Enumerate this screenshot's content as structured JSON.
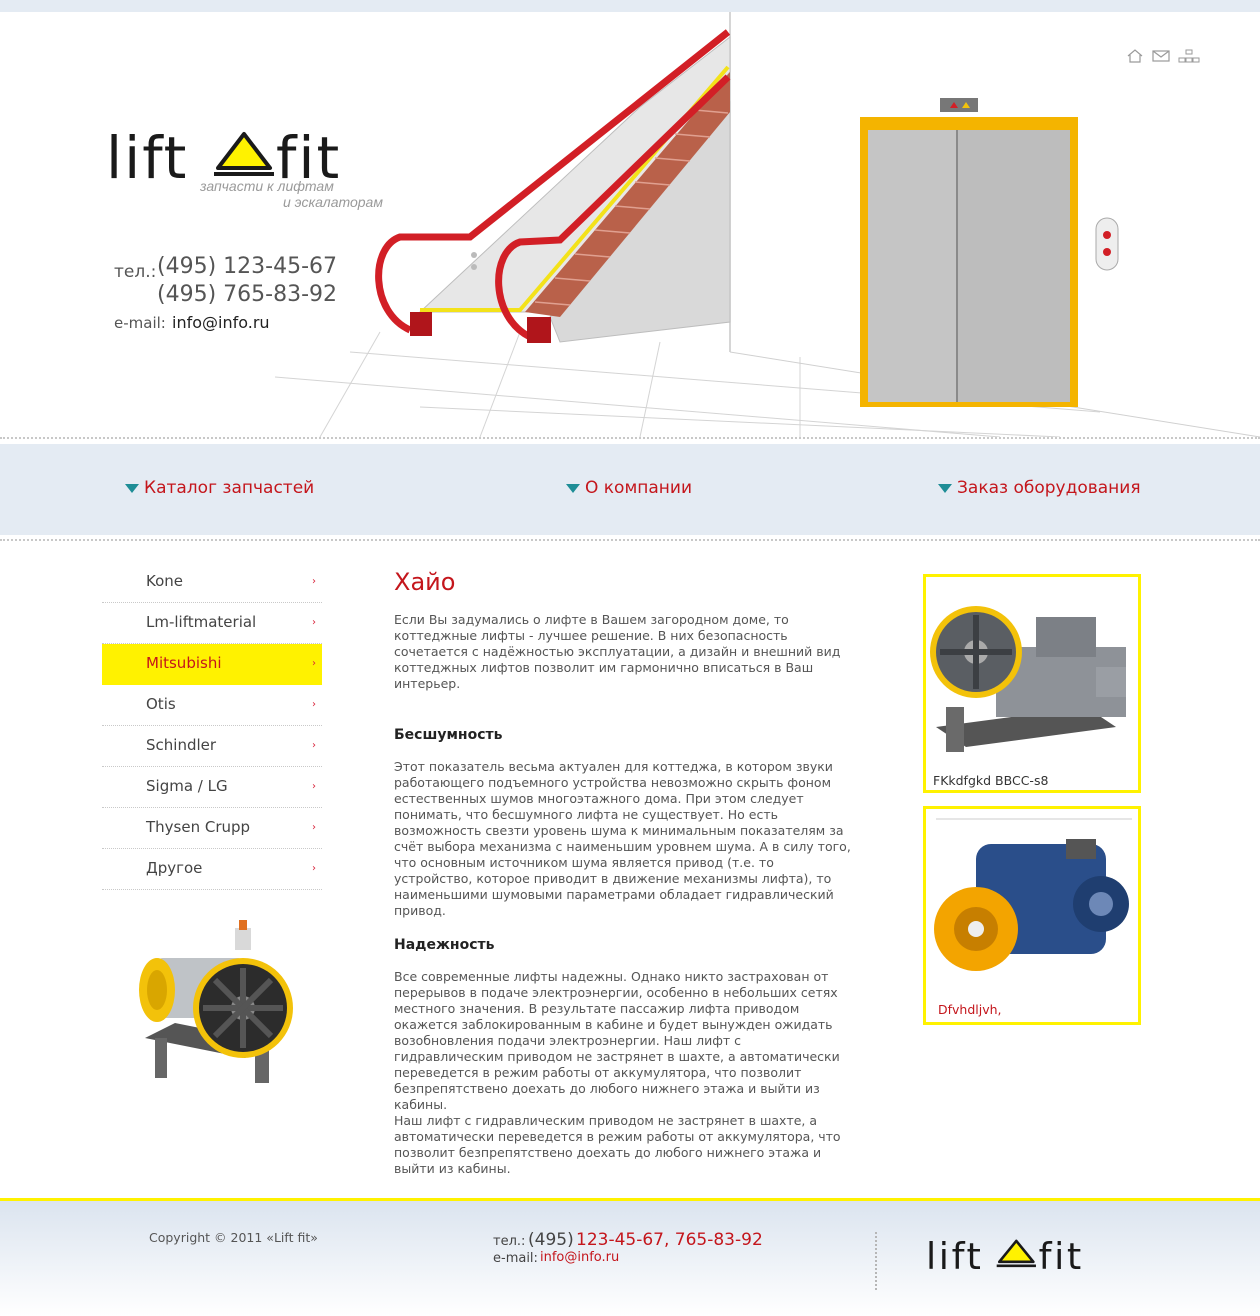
{
  "header": {
    "tagline_line1": "запчасти к лифтам",
    "tagline_line2": "и эскалаторам",
    "phone_label": "тел.:",
    "phone1": "(495) 123-45-67",
    "phone2": "(495) 765-83-92",
    "email_label": "e-mail:",
    "email": "info@info.ru",
    "icons": [
      "home-icon",
      "mail-icon",
      "sitemap-icon"
    ]
  },
  "nav": [
    {
      "label": "Каталог запчастей"
    },
    {
      "label": "О компании"
    },
    {
      "label": "Заказ оборудования"
    }
  ],
  "sidebar": {
    "active_index": 2,
    "items": [
      {
        "label": "Kone"
      },
      {
        "label": "Lm-liftmaterial"
      },
      {
        "label": "Mitsubishi"
      },
      {
        "label": "Otis"
      },
      {
        "label": "Schindler"
      },
      {
        "label": "Sigma / LG"
      },
      {
        "label": "Thysen Crupp"
      },
      {
        "label": "Другое"
      }
    ]
  },
  "content": {
    "title": "Хайо",
    "intro": "Если Вы задумались о лифте в Вашем загородном доме, то коттеджные лифты - лучшее решение. В них безопасность сочетается с надёжностью эксплуатации, а дизайн и внешний вид коттеджных лифтов позволит им гармонично вписаться в Ваш интерьер.",
    "section1_title": "Бесшумность",
    "section1_text": "Этот показатель весьма актуален для коттеджа, в котором звуки работающего подъемного устройства невозможно скрыть фоном естественных шумов многоэтажного дома. При этом следует понимать, что бесшумного лифта не существует. Но есть возможность свезти уровень шума к минимальным показателям за счёт выбора механизма с наименьшим уровнем шума. А в силу того, что основным источником шума является привод (т.е. то устройство, которое приводит в движение механизмы лифта), то наименьшими шумовыми параметрами обладает гидравлический привод.",
    "section2_title": "Надежность",
    "section2_text": "Все современные лифты надежны. Однако никто застрахован от перерывов в подаче электроэнергии, особенно в небольших сетях местного значения. В результате пассажир лифта приводом окажется заблокированным в кабине и будет вынужден ожидать возобновления подачи электроэнергии. Наш лифт с гидравлическим приводом не застрянет в шахте, а автоматически переведется в режим работы от аккумулятора, что позволит безпрепятствено доехать до любого нижнего этажа и выйти из кабины.",
    "section2_text2": "Наш лифт с гидравлическим приводом не застрянет в шахте, а автоматически переведется в режим работы от аккумулятора, что позволит безпрепятствено доехать до любого нижнего этажа и выйти из кабины."
  },
  "cards": [
    {
      "caption": "FKkdfgkd BBCC-s8"
    },
    {
      "caption": "Dfvhdljvh,"
    }
  ],
  "footer": {
    "copyright": "Copyright © 2011 «Lift fit»",
    "tel_label": "тел.:",
    "tel_code": "(495)",
    "tel_numbers": "123-45-67, 765-83-92",
    "email_label": "e-mail:",
    "email": "info@info.ru"
  },
  "colors": {
    "accent_red": "#c4161c",
    "accent_yellow": "#fff200",
    "band_blue": "#e4ebf3",
    "nav_triangle": "#1e8d96"
  }
}
